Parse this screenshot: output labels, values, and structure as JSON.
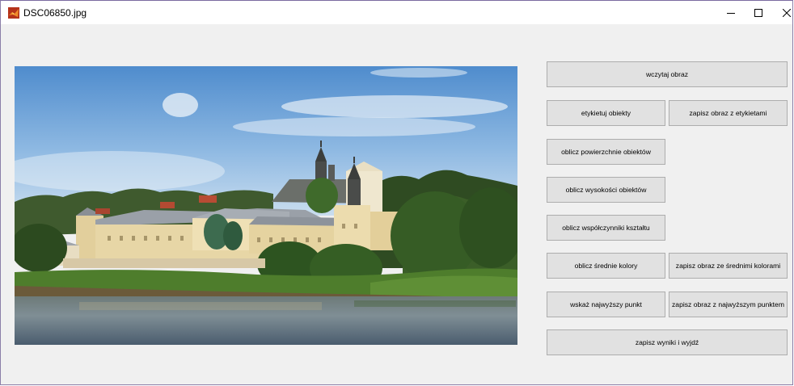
{
  "window": {
    "title": "DSC06850.jpg",
    "icon": "matlab-icon",
    "controls": [
      "minimize-icon",
      "maximize-icon",
      "close-icon"
    ]
  },
  "photo": {
    "subject": "photo-monastery-by-river"
  },
  "buttons": {
    "load_image": "wczytaj obraz",
    "label_objects": "etykietuj obiekty",
    "save_labeled_image": "zapisz obraz z etykietami",
    "compute_area": "oblicz powierzchnie obiektów",
    "compute_height": "oblicz wysokości obiektów",
    "compute_shape_factors": "oblicz współczynniki kształtu",
    "compute_mean_colors": "oblicz średnie kolory",
    "save_mean_colors_image": "zapisz obraz ze średnimi kolorami",
    "show_highest_point": "wskaż najwyższy punkt",
    "save_highest_point_image": "zapisz obraz z najwyższym punktem",
    "save_results_exit": "zapisz wyniki i wyjdź"
  }
}
